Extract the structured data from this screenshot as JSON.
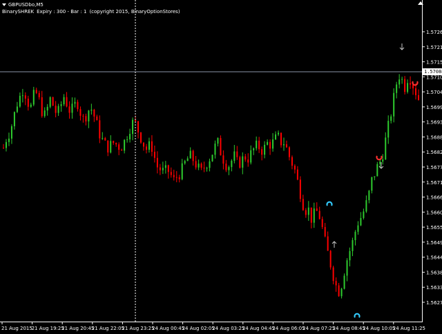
{
  "window": {
    "symbol_title": "GBPUSDbo,M5",
    "indicator": "BinarySHREK",
    "indicator_params": "Expiry : 300 - Bar : 1",
    "indicator_copyright": "(copyright 2015, BinaryOptionStores)"
  },
  "colors": {
    "background": "#000000",
    "up_candle": "#2ecc2e",
    "down_candle": "#ff0000",
    "axis": "#ffffff",
    "price_line": "#8a94a8",
    "vline": "#ffffff",
    "signal_blue": "#33ccff",
    "signal_red": "#ff3030",
    "arrow": "#c8c8c8"
  },
  "current_price": "1.57084",
  "chart_data": {
    "type": "candlestick",
    "y_ticks": [
      "1.57265",
      "1.57210",
      "1.57155",
      "1.57100",
      "1.57045",
      "1.56990",
      "1.56935",
      "1.56880",
      "1.56825",
      "1.56770",
      "1.56715",
      "1.56660",
      "1.56605",
      "1.56550",
      "1.56495",
      "1.56440",
      "1.56385",
      "1.56330",
      "1.56275"
    ],
    "x_ticks": [
      "21 Aug 2015",
      "21 Aug 19:25",
      "21 Aug 20:45",
      "21 Aug 22:05",
      "21 Aug 23:25",
      "24 Aug 00:45",
      "24 Aug 02:05",
      "24 Aug 03:25",
      "24 Aug 04:45",
      "24 Aug 06:05",
      "24 Aug 07:25",
      "24 Aug 08:45",
      "24 Aug 10:05",
      "24 Aug 11:25"
    ],
    "ylim": [
      1.56275,
      1.57265
    ],
    "grid": false,
    "close_path": [
      1.5684,
      1.5688,
      1.569,
      1.5695,
      1.57,
      1.5703,
      1.5706,
      1.5702,
      1.5698,
      1.5703,
      1.5704,
      1.57,
      1.5695,
      1.5698,
      1.5702,
      1.5699,
      1.5696,
      1.5699,
      1.5703,
      1.57,
      1.5697,
      1.5699,
      1.5701,
      1.5697,
      1.5694,
      1.5697,
      1.5699,
      1.5696,
      1.5692,
      1.5688,
      1.5686,
      1.5684,
      1.5685,
      1.5686,
      1.5685,
      1.5684,
      1.5686,
      1.5689,
      1.5692,
      1.5694,
      1.5691,
      1.5688,
      1.5685,
      1.5683,
      1.5686,
      1.5681,
      1.5677,
      1.5676,
      1.5675,
      1.5676,
      1.5674,
      1.5672,
      1.5674,
      1.5675,
      1.5678,
      1.568,
      1.5681,
      1.5679,
      1.5677,
      1.5675,
      1.5677,
      1.5679,
      1.5681,
      1.5684,
      1.5686,
      1.5682,
      1.5679,
      1.5677,
      1.5679,
      1.5681,
      1.5678,
      1.5679,
      1.5681,
      1.568,
      1.5682,
      1.5684,
      1.5685,
      1.5683,
      1.5684,
      1.5686,
      1.5685,
      1.5687,
      1.5688,
      1.5686,
      1.5686,
      1.5682,
      1.5679,
      1.5676,
      1.5671,
      1.5666,
      1.5661,
      1.5662,
      1.5658,
      1.566,
      1.5661,
      1.5656,
      1.565,
      1.5645,
      1.564,
      1.5635,
      1.5631,
      1.5634,
      1.564,
      1.5645,
      1.5648,
      1.5653,
      1.5657,
      1.5659,
      1.5662,
      1.5666,
      1.5672,
      1.5675,
      1.5678,
      1.568,
      1.5686,
      1.5692,
      1.5698,
      1.5705,
      1.5711,
      1.5709,
      1.5706,
      1.5711,
      1.5708,
      1.5705,
      1.5702
    ]
  },
  "signals": [
    {
      "type": "call",
      "label": "call-signal"
    },
    {
      "type": "put",
      "label": "put-signal"
    }
  ]
}
